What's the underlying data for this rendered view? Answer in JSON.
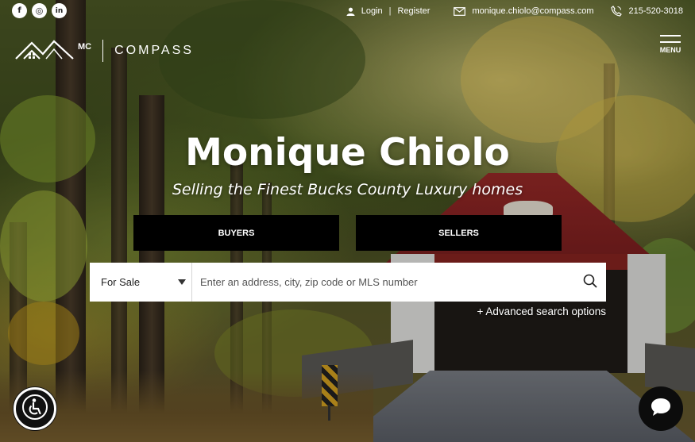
{
  "social": [
    {
      "name": "facebook",
      "glyph": "f"
    },
    {
      "name": "instagram",
      "glyph": "◎"
    },
    {
      "name": "linkedin",
      "glyph": "in"
    }
  ],
  "topbar": {
    "login": "Login",
    "separator": "|",
    "register": "Register",
    "email": "monique.chiolo@compass.com",
    "phone": "215-520-3018"
  },
  "logo": {
    "initials": "MC",
    "brand": "COMPASS"
  },
  "menu": {
    "label": "MENU"
  },
  "hero": {
    "title": "Monique Chiolo",
    "subtitle": "Selling the Finest Bucks County Luxury homes"
  },
  "tabs": {
    "buyers": "BUYERS",
    "sellers": "SELLERS"
  },
  "search": {
    "type_selected": "For Sale",
    "placeholder": "Enter an address, city, zip code or MLS number",
    "advanced": "+ Advanced search options"
  },
  "icons": {
    "user": "user-icon",
    "mail": "mail-icon",
    "phone": "phone-icon",
    "search": "search-icon",
    "accessibility": "accessibility-icon",
    "chat": "chat-icon"
  }
}
